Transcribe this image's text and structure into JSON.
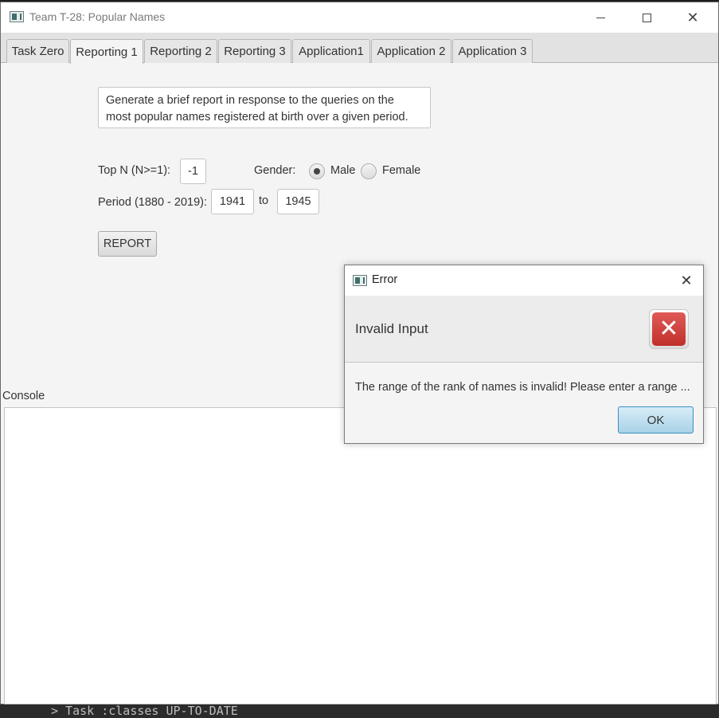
{
  "window": {
    "title": "Team T-28: Popular Names"
  },
  "tabs": [
    {
      "label": "Task Zero",
      "active": false
    },
    {
      "label": "Reporting 1",
      "active": true
    },
    {
      "label": "Reporting 2",
      "active": false
    },
    {
      "label": "Reporting 3",
      "active": false
    },
    {
      "label": "Application1",
      "active": false
    },
    {
      "label": "Application 2",
      "active": false
    },
    {
      "label": "Application 3",
      "active": false
    }
  ],
  "reporting1": {
    "description_line1": "Generate a brief report in response to the queries on the",
    "description_line2": "most popular names registered at birth over a given period.",
    "topn_label": "Top N (N>=1):",
    "topn_value": "-1",
    "gender_label": "Gender:",
    "gender_options": [
      "Male",
      "Female"
    ],
    "gender_selected": "Male",
    "period_label": "Period (1880 - 2019):",
    "period_from": "1941",
    "period_to_label": "to",
    "period_to": "1945",
    "report_button": "REPORT"
  },
  "console": {
    "label": "Console"
  },
  "dialog": {
    "title": "Error",
    "header": "Invalid Input",
    "message": "The range of the rank of names is invalid! Please enter a range ...",
    "ok_button": "OK"
  },
  "background": {
    "terminal_text": "> Task :classes UP-TO-DATE"
  },
  "colors": {
    "window_bg": "#f4f4f4",
    "ok_button_border": "#3c8fc0",
    "error_icon": "#c0302c"
  }
}
